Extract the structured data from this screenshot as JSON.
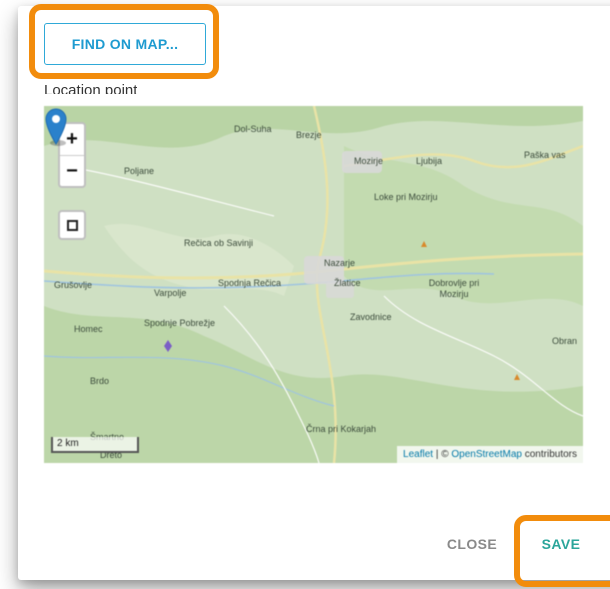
{
  "dialog": {
    "find_button_label": "FIND ON MAP...",
    "location_label": "Location point",
    "close_label": "CLOSE",
    "save_label": "SAVE"
  },
  "map": {
    "zoom_in_label": "+",
    "zoom_out_label": "−",
    "scale_label": "2 km",
    "attribution": {
      "leaflet": "Leaflet",
      "separator": " | © ",
      "osm": "OpenStreetMap",
      "contributors": " contributors"
    },
    "place_labels": {
      "dol_suha": "Dol-Suha",
      "brezje": "Brezje",
      "mozirje": "Mozirje",
      "ljubija": "Ljubija",
      "packa_vas": "Paška vas",
      "poljane": "Poljane",
      "loke_pri_mozirju": "Loke pri Mozirju",
      "recica_ob_savinji": "Rečica ob Savinji",
      "spodnja_recica": "Spodnja Rečica",
      "nazarje": "Nazarje",
      "zlatice": "Žlatice",
      "dobrovlje_pri_mozirju": "Dobrovlje pri Mozirju",
      "grusovlje": "Grušovlje",
      "varpolje": "Varpolje",
      "spodnje_pobrezje": "Spodnje Pobrežje",
      "zavodnice": "Zavodnice",
      "homec": "Homec",
      "obran": "Obran",
      "brdo": "Brdo",
      "crna_pri_kokarjah": "Črna pri Kokarjah",
      "smartno": "Šmartno",
      "dreto": "Dreto"
    }
  },
  "colors": {
    "accent_blue": "#1e9bd0",
    "save_teal": "#2aa59a",
    "highlight_orange": "#f28c0c",
    "marker_blue": "#2a81cb"
  },
  "icons": {
    "locate": "square-target-icon",
    "marker": "map-pin-icon"
  }
}
